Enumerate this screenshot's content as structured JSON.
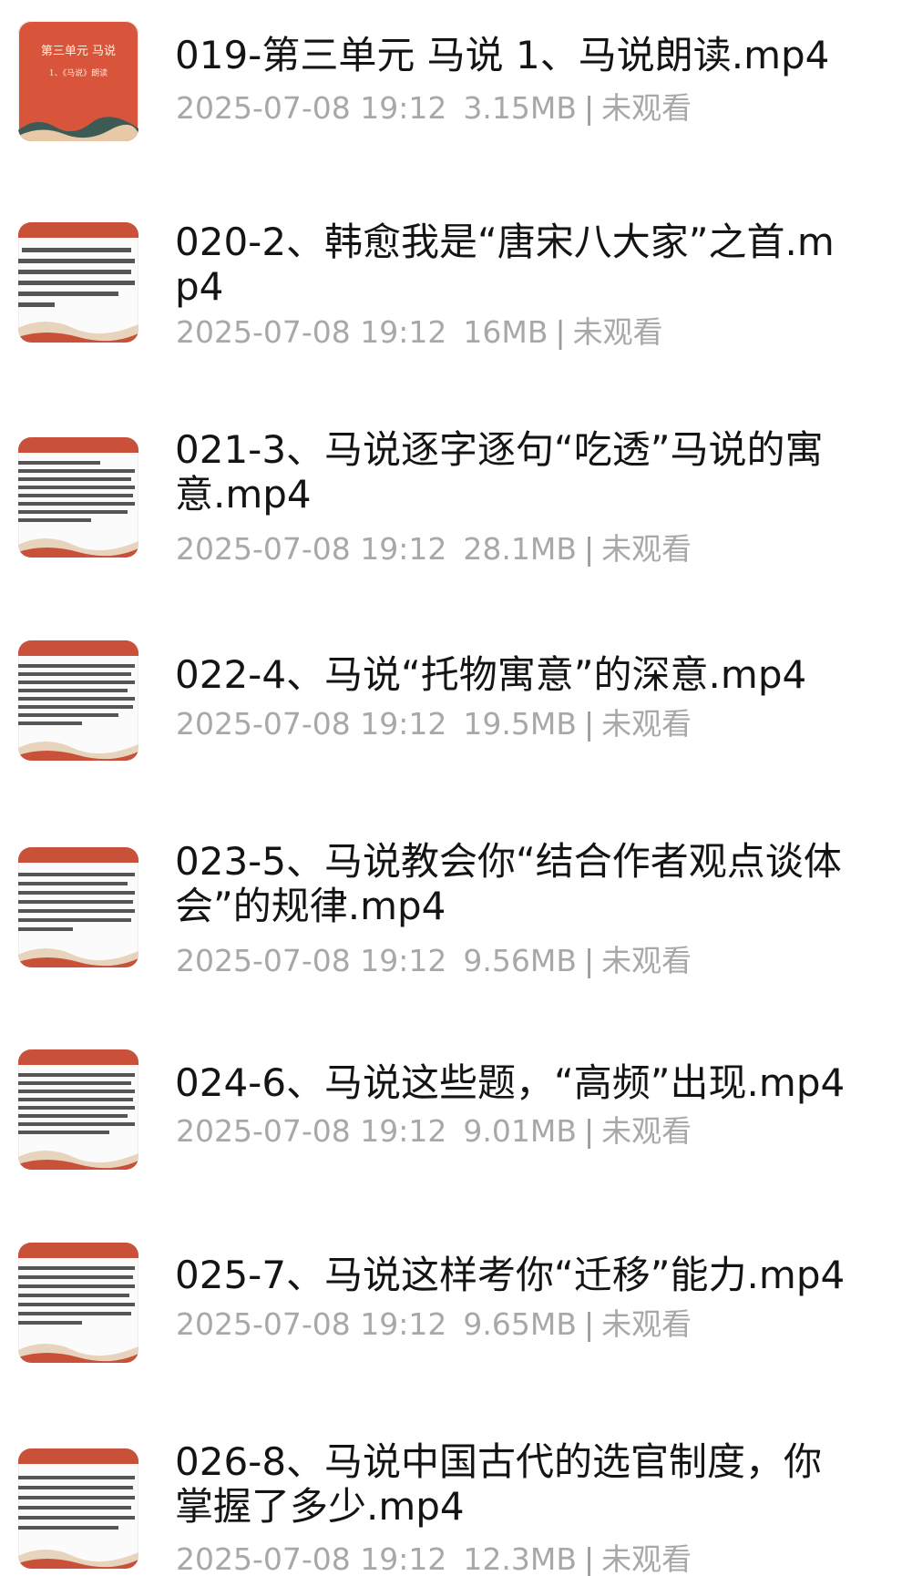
{
  "cover": {
    "title": "第三单元  马说",
    "subtitle": "1、《马说》朗读"
  },
  "files": [
    {
      "name": "019-第三单元 马说 1、马说朗读.mp4",
      "date": "2025-07-08 19:12",
      "size": "3.15MB",
      "status": "未观看"
    },
    {
      "name": "020-2、韩愈我是“唐宋八大家”之首.mp4",
      "date": "2025-07-08 19:12",
      "size": "16MB",
      "status": "未观看"
    },
    {
      "name": "021-3、马说逐字逐句“吃透”马说的寓意.mp4",
      "date": "2025-07-08 19:12",
      "size": "28.1MB",
      "status": "未观看"
    },
    {
      "name": "022-4、马说“托物寓意”的深意.mp4",
      "date": "2025-07-08 19:12",
      "size": "19.5MB",
      "status": "未观看"
    },
    {
      "name": "023-5、马说教会你“结合作者观点谈体会”的规律.mp4",
      "date": "2025-07-08 19:12",
      "size": "9.56MB",
      "status": "未观看"
    },
    {
      "name": "024-6、马说这些题，“高频”出现.mp4",
      "date": "2025-07-08 19:12",
      "size": "9.01MB",
      "status": "未观看"
    },
    {
      "name": "025-7、马说这样考你“迁移”能力.mp4",
      "date": "2025-07-08 19:12",
      "size": "9.65MB",
      "status": "未观看"
    },
    {
      "name": "026-8、马说中国古代的选官制度，你掌握了多少.mp4",
      "date": "2025-07-08 19:12",
      "size": "12.3MB",
      "status": "未观看"
    }
  ]
}
